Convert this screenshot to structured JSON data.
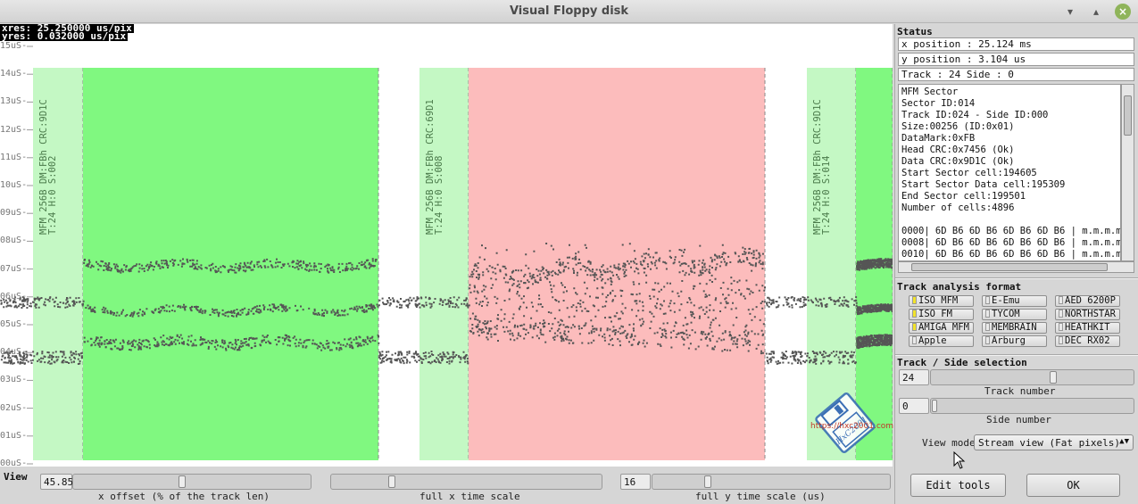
{
  "window": {
    "title": "Visual Floppy disk"
  },
  "window_controls": {
    "minimize": "▾",
    "maximize": "▴",
    "close": "×"
  },
  "plot": {
    "xres": "xres: 25.250000 us/pix",
    "yres": "yres: 0.032000 us/pix",
    "y_labels": [
      "15uS-",
      "14uS-",
      "13uS-",
      "12uS-",
      "11uS-",
      "10uS-",
      "09uS-",
      "08uS-",
      "07uS-",
      "06uS-",
      "05uS-",
      "04uS-",
      "03uS-",
      "02uS-",
      "01uS-",
      "00uS-"
    ],
    "sector_labels": [
      {
        "line1": "MFM  256B DM:FBh CRC:9D1C",
        "line2": "T:24 H:0 S:002"
      },
      {
        "line1": "MFM  256B DM:FBh CRC:69D1",
        "line2": "T:24 H:0 S:008"
      },
      {
        "line1": "MFM  256B DM:FBh CRC:9D1C",
        "line2": "T:24 H:0 S:014"
      }
    ],
    "logo_text": "HxC2001",
    "logo_url": "https://hxc2001.com",
    "colors": {
      "ok_sector": "#80f880",
      "ok_header": "#c4f8c4",
      "bad_sector": "#fcbcbc",
      "dots": "#555555"
    }
  },
  "bottom": {
    "view_label": "View",
    "x_offset_value": "45.85",
    "x_offset_caption": "x offset (% of the track len)",
    "full_x_caption": "full x time scale",
    "y_scale_value": "16",
    "y_scale_caption": "full y time scale (us)",
    "x_offset_percent": 45.85,
    "edit_tools_label": "Edit tools",
    "ok_label": "OK"
  },
  "status": {
    "title": "Status",
    "x_position": "x position : 25.124 ms",
    "y_position": "y position : 3.104 us",
    "track_side": "Track : 24 Side : 0",
    "details": "MFM Sector\nSector ID:014\nTrack ID:024 - Side ID:000\nSize:00256 (ID:0x01)\nDataMark:0xFB\nHead CRC:0x7456 (Ok)\nData CRC:0x9D1C (Ok)\nStart Sector cell:194605\nStart Sector Data cell:195309\nEnd Sector cell:199501\nNumber of cells:4896\n\n0000| 6D B6 6D B6 6D B6 6D B6 | m.m.m.m.\n0008| 6D B6 6D B6 6D B6 6D B6 | m.m.m.m.\n0010| 6D B6 6D B6 6D B6 6D B6 | m.m.m.m."
  },
  "formats": {
    "title": "Track analysis format",
    "items": [
      {
        "label": "ISO MFM",
        "on": true
      },
      {
        "label": "E-Emu",
        "on": false
      },
      {
        "label": "AED 6200P",
        "on": false
      },
      {
        "label": "ISO FM",
        "on": true
      },
      {
        "label": "TYCOM",
        "on": false
      },
      {
        "label": "NORTHSTAR",
        "on": false
      },
      {
        "label": "AMIGA MFM",
        "on": true
      },
      {
        "label": "MEMBRAIN",
        "on": false
      },
      {
        "label": "HEATHKIT",
        "on": false
      },
      {
        "label": "Apple",
        "on": false
      },
      {
        "label": "Arburg",
        "on": false
      },
      {
        "label": "DEC RX02",
        "on": false
      }
    ]
  },
  "selection": {
    "title": "Track / Side selection",
    "track_value": "24",
    "track_caption": "Track number",
    "side_value": "0",
    "side_caption": "Side number",
    "view_mode_label": "View mode",
    "view_mode_value": "Stream view (Fat pixels)",
    "view_mode_arrow": "▲▼"
  }
}
